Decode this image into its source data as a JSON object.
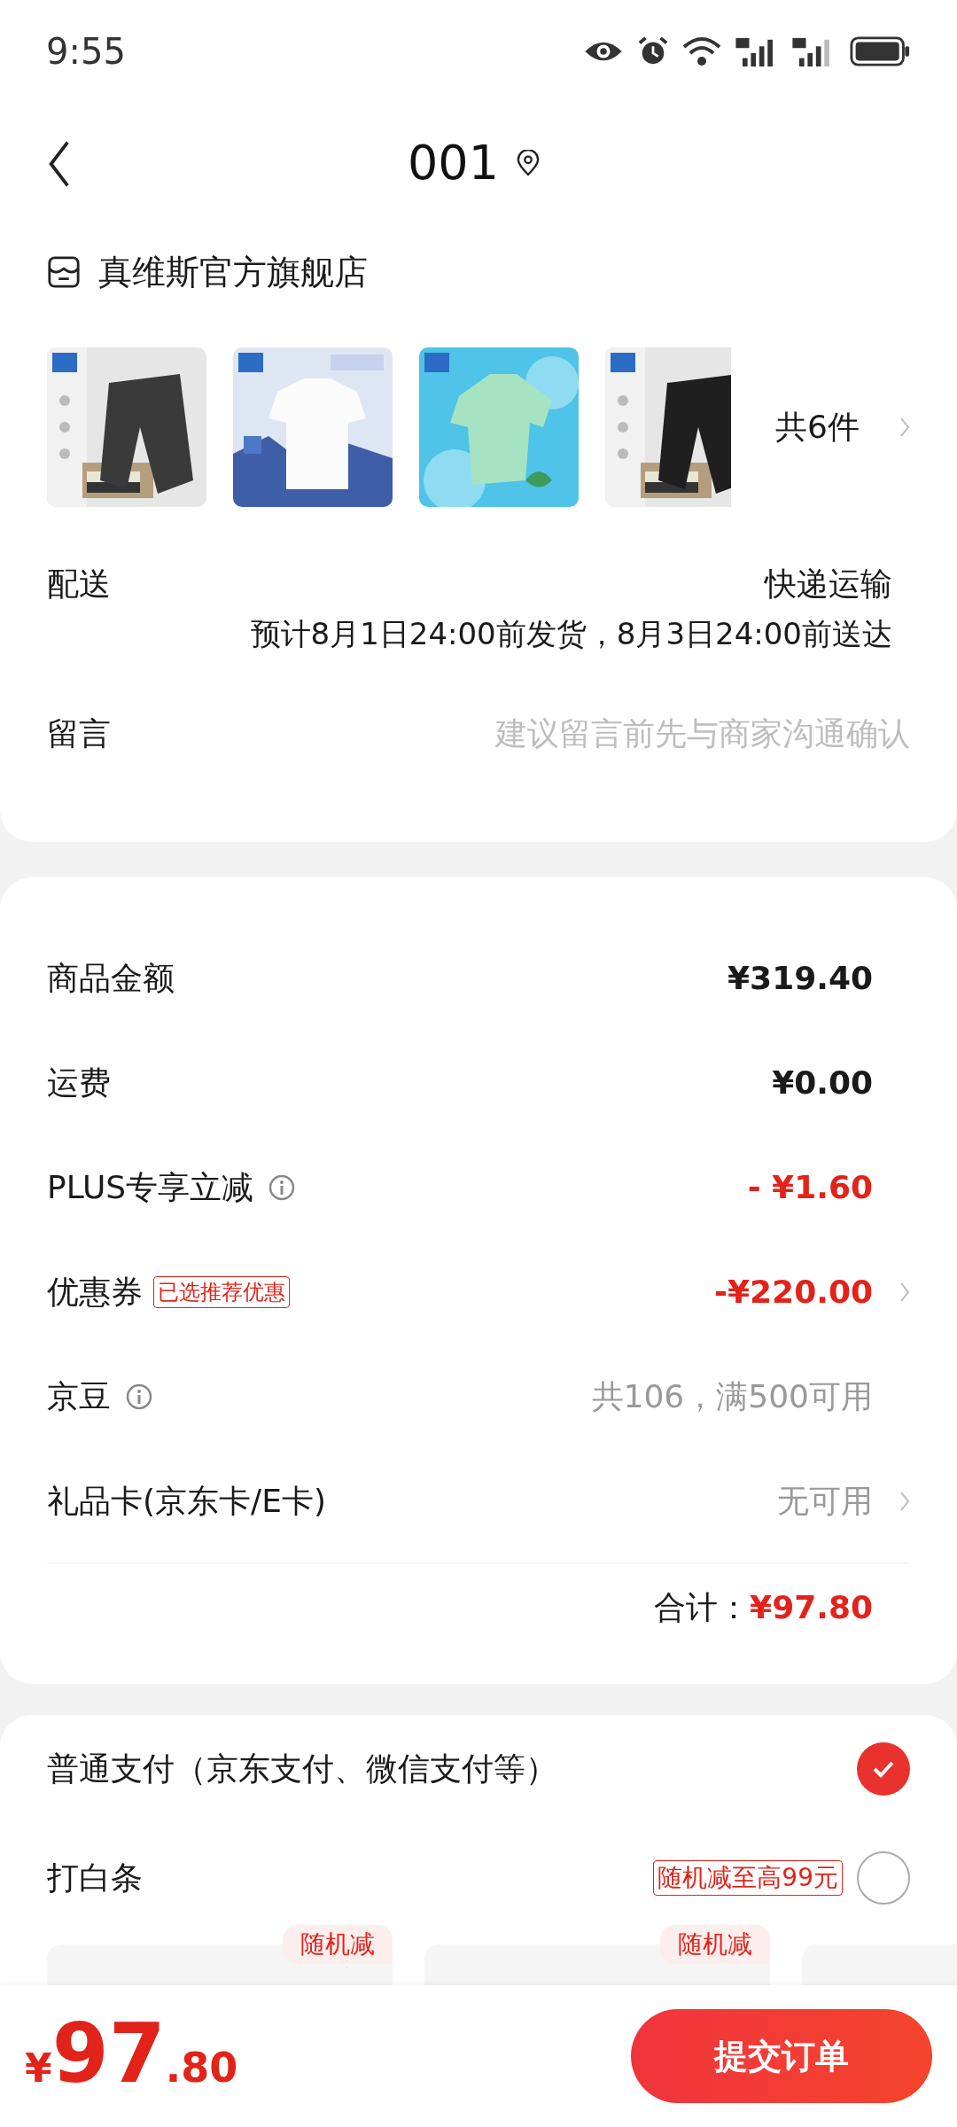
{
  "status_bar": {
    "time": "9:55"
  },
  "header": {
    "title": "001"
  },
  "store": {
    "name": "真维斯官方旗舰店",
    "count": "共6件"
  },
  "delivery": {
    "label": "配送",
    "method": "快递运输",
    "estimate": "预计8月1日24:00前发货，8月3日24:00前送达"
  },
  "message": {
    "label": "留言",
    "placeholder": "建议留言前先与商家沟通确认"
  },
  "summary": {
    "rows": [
      {
        "label": "商品金额",
        "value": "¥319.40",
        "kind": "amount"
      },
      {
        "label": "运费",
        "value": "¥0.00",
        "kind": "amount"
      },
      {
        "label": "PLUS专享立减",
        "info": true,
        "value": "- ¥1.60",
        "kind": "discount"
      },
      {
        "label": "优惠券",
        "tag": "已选推荐优惠",
        "value": "-¥220.00",
        "kind": "discount",
        "chevron": true
      },
      {
        "label": "京豆",
        "info": true,
        "value": "共106，满500可用",
        "kind": "muted"
      },
      {
        "label": "礼品卡(京东卡/E卡)",
        "value": "无可用",
        "kind": "muted",
        "chevron": true
      }
    ],
    "total_label": "合计：",
    "total": "¥97.80"
  },
  "payment": {
    "options": [
      {
        "label": "普通支付（京东支付、微信支付等）",
        "selected": true
      },
      {
        "label": "打白条",
        "tag": "随机减至高99元",
        "selected": false
      }
    ],
    "installments": [
      {
        "kind": "tagged",
        "tag": "随机减"
      },
      {
        "kind": "tagged",
        "tag": "随机减"
      },
      {
        "kind": "plain"
      }
    ]
  },
  "bottom_bar": {
    "currency": "¥",
    "price_int": "97",
    "price_dec": ".80",
    "submit": "提交订单"
  }
}
